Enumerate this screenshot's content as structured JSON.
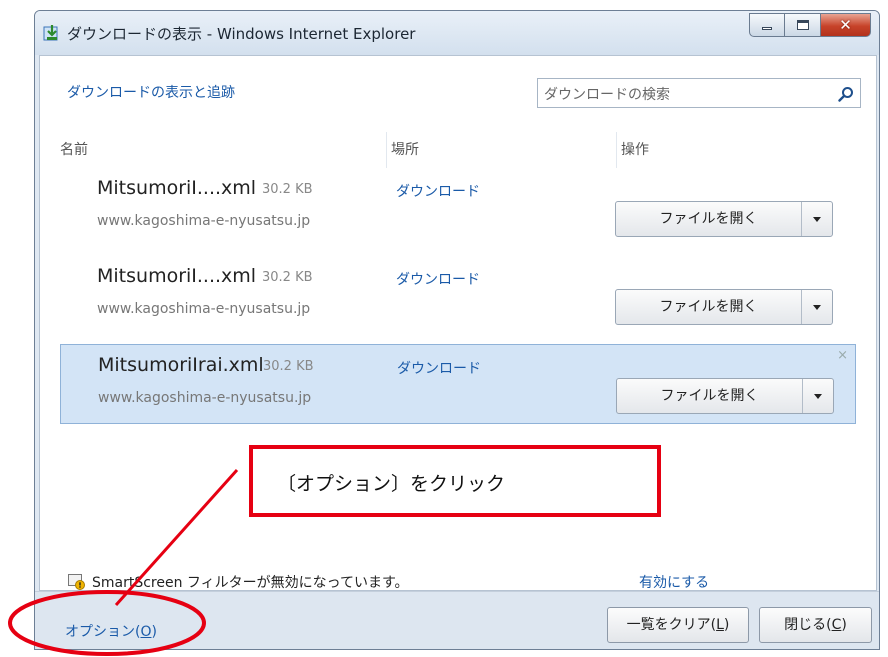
{
  "window": {
    "title": "ダウンロードの表示 - Windows Internet Explorer"
  },
  "header": {
    "track_link": "ダウンロードの表示と追跡",
    "search_placeholder": "ダウンロードの検索"
  },
  "columns": {
    "name": "名前",
    "location": "場所",
    "action": "操作"
  },
  "downloads": [
    {
      "file": "MitsumoriI....xml",
      "size": "30.2 KB",
      "location": "ダウンロード",
      "site": "www.kagoshima-e-nyusatsu.jp",
      "action": "ファイルを開く",
      "selected": false
    },
    {
      "file": "MitsumoriI....xml",
      "size": "30.2 KB",
      "location": "ダウンロード",
      "site": "www.kagoshima-e-nyusatsu.jp",
      "action": "ファイルを開く",
      "selected": false
    },
    {
      "file": "MitsumoriIrai.xml",
      "size": "30.2 KB",
      "location": "ダウンロード",
      "site": "www.kagoshima-e-nyusatsu.jp",
      "action": "ファイルを開く",
      "selected": true,
      "close_glyph": "×"
    }
  ],
  "infobar": {
    "smartscreen_text": "SmartScreen フィルターが無効になっています。",
    "enable_link": "有効にする"
  },
  "footer": {
    "options_label": "オプション(",
    "options_key": "O",
    "options_suffix": ")",
    "clear_label": "一覧をクリア(",
    "clear_key": "L",
    "clear_suffix": ")",
    "close_label": "閉じる(",
    "close_key": "C",
    "close_suffix": ")"
  },
  "annotation": {
    "callout_text": "〔オプション〕をクリック",
    "color": "#e60012"
  },
  "icons": {
    "title": "ie-download-icon",
    "search": "search-icon",
    "shield": "smartscreen-shield-icon"
  }
}
